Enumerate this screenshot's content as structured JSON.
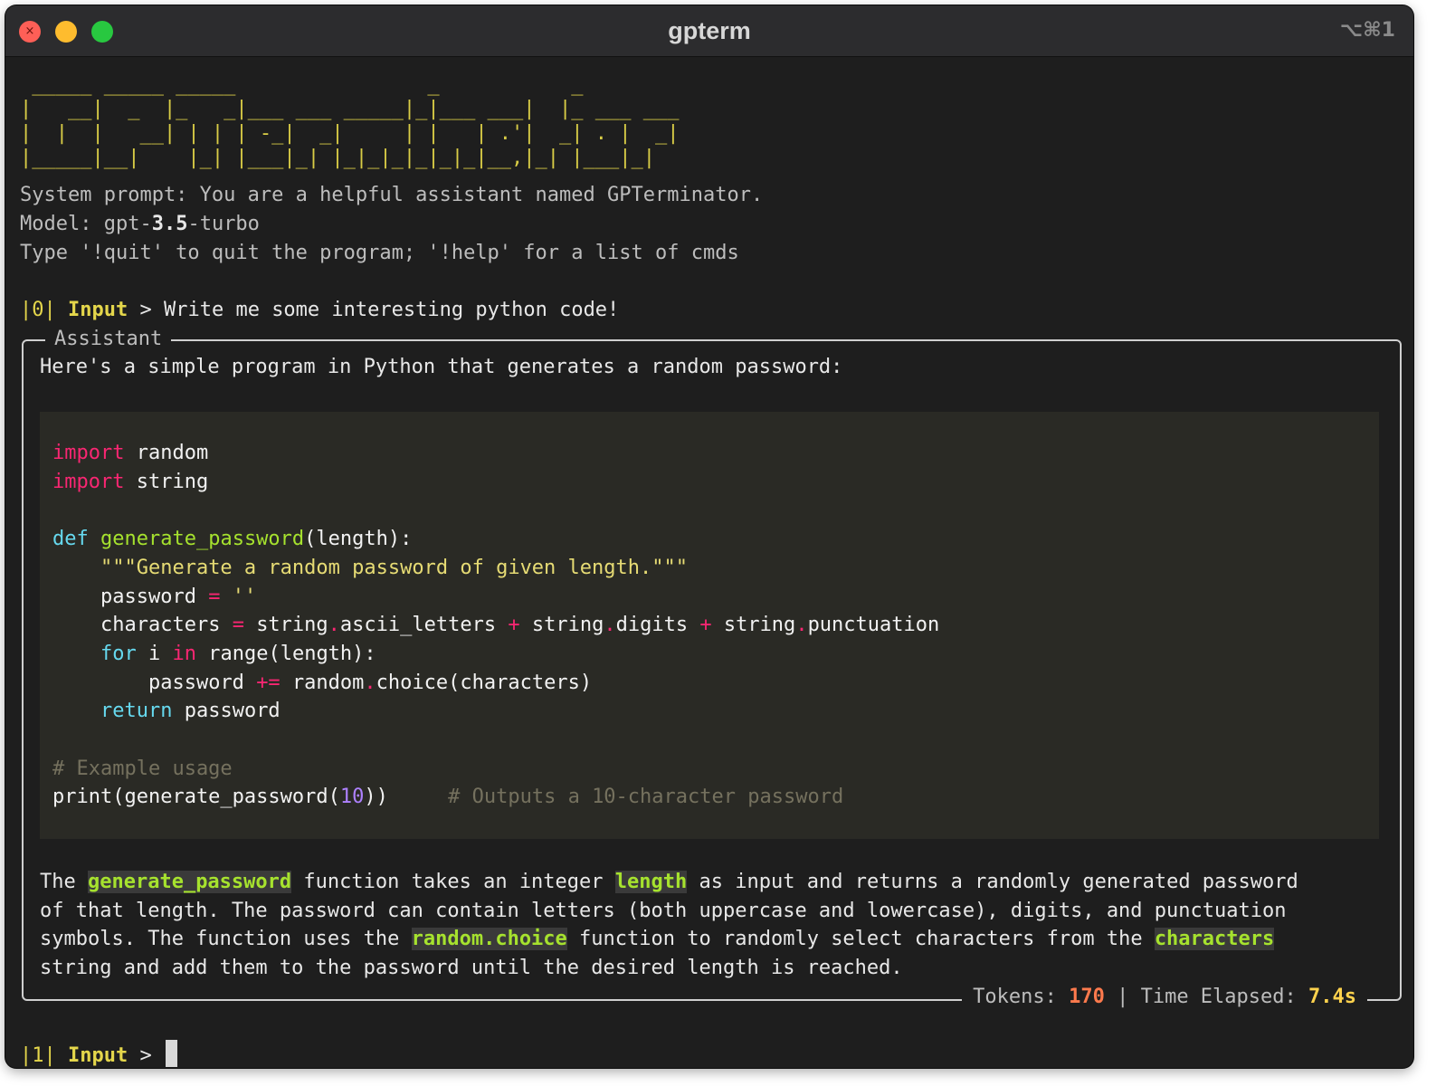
{
  "window": {
    "title": "gpterm",
    "shortcut": "⌥⌘1"
  },
  "banner_art": [
    " _____ _____ _____                _           _ ",
    "|   __|  _  |_   _|___ ___ _____|_|___ ___|  |_ ___ ___ ",
    "|  |  |   __| | | | -_|  _|     | |   | .'|  _| . |  _|",
    "|_____|__|    |_| |___|_| |_|_|_|_|_|_|__,|_| |___|_|"
  ],
  "header": {
    "system_prompt": "System prompt: You are a helpful assistant named GPTerminator.",
    "model_label": "Model: gpt-",
    "model_version": "3.5",
    "model_suffix": "-turbo",
    "help_text": "Type '!quit' to quit the program; '!help' for a list of cmds"
  },
  "prompt0": {
    "num": "|0|",
    "label": "Input",
    "arrow": " > ",
    "text": "Write me some interesting python code!"
  },
  "assistant": {
    "label": "Assistant",
    "intro": "Here's a simple program in Python that generates a random password:",
    "code": {
      "l1_kw": "import",
      "l1_rest": " random",
      "l2_kw": "import",
      "l2_rest": " string",
      "l4_def": "def",
      "l4_fn": "generate_password",
      "l4_rest": "(length):",
      "l5_str": "\"\"\"Generate a random password of given length.\"\"\"",
      "l6_a": "password",
      "l6_op": "=",
      "l6_str": "''",
      "l7_a": "characters",
      "l7_op1": "=",
      "l7_b": "string",
      "l7_c": "ascii_letters",
      "l7_op2": "+",
      "l7_d": "string",
      "l7_e": "digits",
      "l7_op3": "+",
      "l7_f": "string",
      "l7_g": "punctuation",
      "l8_for": "for",
      "l8_i": "i",
      "l8_in": "in",
      "l8_rest": "range(length):",
      "l9_a": "password",
      "l9_op": "+=",
      "l9_b": "random",
      "l9_c": "choice(characters)",
      "l10_kw": "return",
      "l10_rest": "password",
      "l12_cm": "# Example usage",
      "l13_a": "print(generate_password(",
      "l13_num": "10",
      "l13_b": "))",
      "l13_cm": "# Outputs a 10-character password"
    },
    "para": {
      "p1a": "The ",
      "p1hl1": "generate_password",
      "p1b": " function takes an integer ",
      "p1hl2": "length",
      "p1c": " as input and returns a randomly generated password",
      "p2": "of that length. The password can contain letters (both uppercase and lowercase), digits, and punctuation",
      "p3a": "symbols. The function uses the ",
      "p3hl1": "random.choice",
      "p3b": " function to randomly select characters from the ",
      "p3hl2": "characters",
      "p4": "string and add them to the password until the desired length is reached."
    },
    "footer": {
      "tokens_label": "Tokens: ",
      "tokens_value": "170",
      "sep": " | ",
      "time_label": "Time Elapsed: ",
      "time_value": "7.4s"
    }
  },
  "prompt1": {
    "num": "|1|",
    "label": "Input",
    "arrow": " > "
  },
  "colors": {
    "background": "#1e1e1e",
    "banner": "#d8cc46",
    "keyword": "#f92672",
    "function": "#a6e22e",
    "string": "#e6db74",
    "tokens": "#ff7a4d",
    "time": "#ffd24d"
  }
}
